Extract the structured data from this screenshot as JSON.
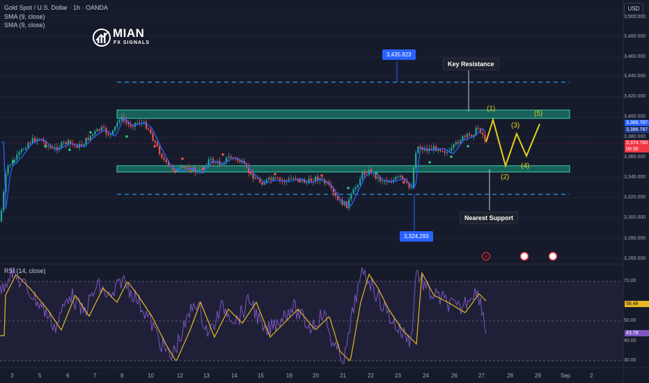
{
  "header": {
    "title": "Gold Spot / U.S. Dollar · 1h · OANDA",
    "indicator1": "SMA (9, close)",
    "indicator2": "SMA (9, close)",
    "currency_button": "USD"
  },
  "logo": {
    "name": "MIAN",
    "sub": "FX SIGNALS"
  },
  "annotations": {
    "key_resistance": "Key Resistance",
    "nearest_support": "Nearest Support",
    "upper_price": "3,435.823",
    "lower_price": "3,324.293",
    "waves": [
      "(1)",
      "(2)",
      "(3)",
      "(4)",
      "(5)"
    ]
  },
  "price_axis": {
    "labels": [
      "3,480.000",
      "3,460.000",
      "3,440.000",
      "3,420.000",
      "3,400.000",
      "3,380.000",
      "3,360.000",
      "3,340.000",
      "3,320.000",
      "3,300.000",
      "3,280.000",
      "3,260.000"
    ],
    "top_label": "3,500.000",
    "sma_tag1": "3,386.787",
    "sma_tag2": "3,386.787",
    "last_price": "3,374.760",
    "countdown": "09:36"
  },
  "rsi": {
    "label": "RSI (14, close)",
    "levels": [
      "70.00",
      "50.00",
      "40.00",
      "30.00"
    ],
    "value_tag": "58.48",
    "rsi_tag": "43.78"
  },
  "time_axis": [
    "3",
    "5",
    "6",
    "7",
    "8",
    "10",
    "12",
    "13",
    "14",
    "15",
    "19",
    "20",
    "21",
    "22",
    "23",
    "24",
    "26",
    "27",
    "28",
    "29",
    "Sep",
    "2"
  ],
  "colors": {
    "background": "#161b2b",
    "up_candle": "#26a69a",
    "down_candle": "#ef5350",
    "zone": "#1a7a68",
    "wave": "#e8d21a",
    "sma": "#2962ff",
    "rsi_line": "#7e57c2",
    "rsi_ma": "#e8b923",
    "tag_blue": "#2962ff",
    "tag_red": "#f23645"
  },
  "chart_data": {
    "type": "candlestick",
    "symbol": "XAUUSD 1h",
    "key_levels": {
      "upper_dashed": 3435.823,
      "resistance_zone": [
        3400,
        3405
      ],
      "support_zone": [
        3347,
        3352
      ],
      "lower_dashed": 3324.293
    },
    "last_price": 3374.76,
    "sma": 3386.787,
    "rsi": {
      "value": 43.78,
      "ma": 58.48,
      "overbought": 70,
      "oversold": 30
    }
  }
}
